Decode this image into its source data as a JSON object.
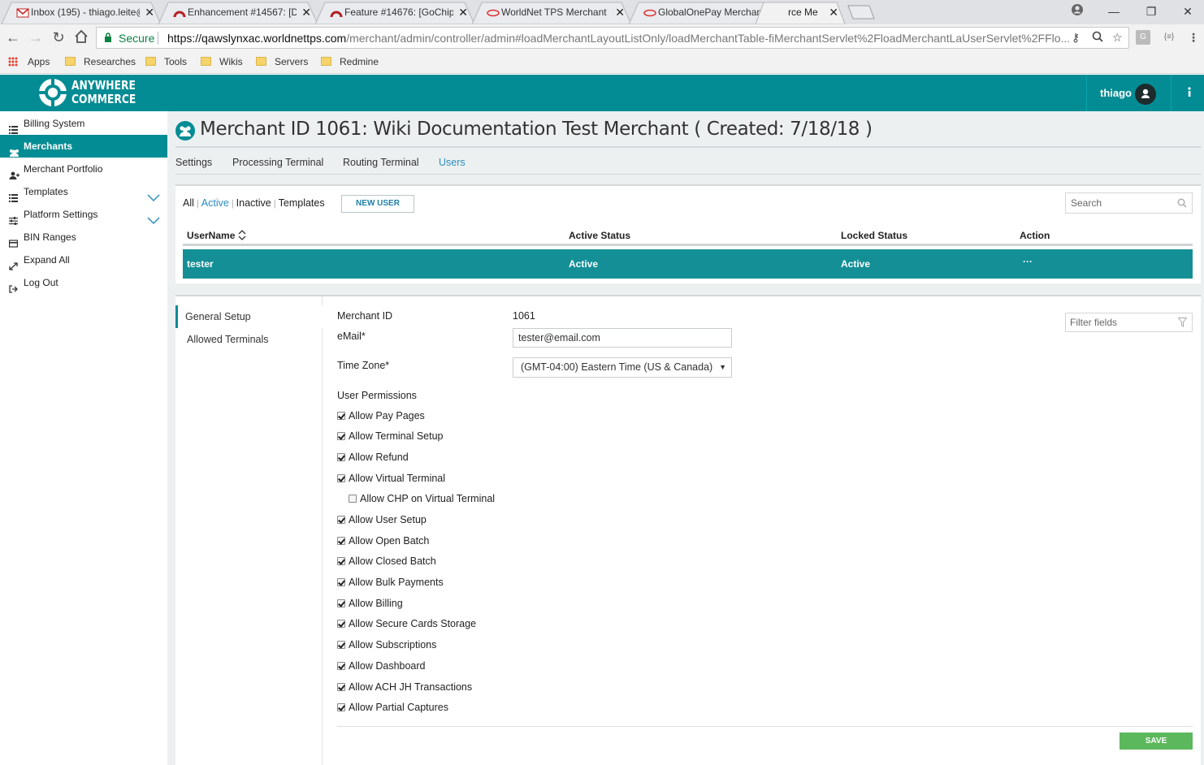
{
  "browser": {
    "tabs": [
      {
        "title": "Inbox (195) - thiago.leite@",
        "close": "✕"
      },
      {
        "title": "Enhancement #14567: [D",
        "close": "✕"
      },
      {
        "title": "Feature #14676: [GoChip",
        "close": "✕"
      },
      {
        "title": "WorldNet TPS Merchant",
        "close": "✕"
      },
      {
        "title": "GlobalOnePay Merchant",
        "close": "✕"
      },
      {
        "title": "rce Me",
        "close": "✕"
      }
    ],
    "address": {
      "secure_label": "Secure",
      "url_host": "https://qawslynxac.worldnettps.com",
      "url_path": "/merchant/admin/controller/admin#loadMerchantLayoutListOnly/loadMerchantTable-fiMerchantServlet%2FloadMerchantLaUserServlet%2FFlo..."
    },
    "bookmarks": [
      "Apps",
      "Researches",
      "Tools",
      "Wikis",
      "Servers",
      "Redmine"
    ]
  },
  "header": {
    "logo_line1": "ANYWHERE",
    "logo_line2": "COMMERCE",
    "username": "thiago",
    "brand_color": "#048c94"
  },
  "sidebar": {
    "items": [
      {
        "label": "Billing System",
        "icon": "list-icon"
      },
      {
        "label": "Merchants",
        "icon": "users-icon",
        "active": true
      },
      {
        "label": "Merchant Portfolio",
        "icon": "user-add-icon"
      },
      {
        "label": "Templates",
        "icon": "list-icon",
        "expandable": true
      },
      {
        "label": "Platform Settings",
        "icon": "sliders-icon",
        "expandable": true
      },
      {
        "label": "BIN Ranges",
        "icon": "card-icon"
      },
      {
        "label": "Expand All",
        "icon": "expand-icon"
      },
      {
        "label": "Log Out",
        "icon": "logout-icon"
      }
    ]
  },
  "main": {
    "title": "Merchant ID 1061: Wiki Documentation Test Merchant ( Created: 7/18/18 )",
    "tabs": [
      "Settings",
      "Processing Terminal",
      "Routing Terminal",
      "Users"
    ],
    "active_tab": "Users",
    "filters": {
      "all": "All",
      "active": "Active",
      "inactive": "Inactive",
      "templates": "Templates"
    },
    "new_user_label": "NEW USER",
    "search_placeholder": "Search",
    "table": {
      "headers": [
        "UserName",
        "Active Status",
        "Locked Status",
        "Action"
      ],
      "rows": [
        {
          "username": "tester",
          "active_status": "Active",
          "locked_status": "Active",
          "action": "···"
        }
      ]
    },
    "detail": {
      "nav": [
        "General Setup",
        "Allowed Terminals"
      ],
      "labels": {
        "merchant_id": "Merchant ID",
        "email": "eMail*",
        "time_zone": "Time Zone*",
        "permissions": "User Permissions"
      },
      "merchant_id_value": "1061",
      "email_value": "tester@email.com",
      "time_zone_value": "(GMT-04:00) Eastern Time (US & Canada)",
      "filter_placeholder": "Filter fields",
      "permissions": [
        {
          "label": "Allow Pay Pages",
          "checked": true
        },
        {
          "label": "Allow Terminal Setup",
          "checked": true
        },
        {
          "label": "Allow Refund",
          "checked": true
        },
        {
          "label": "Allow Virtual Terminal",
          "checked": true
        },
        {
          "label": "Allow CHP on Virtual Terminal",
          "checked": false,
          "indent": true
        },
        {
          "label": "Allow User Setup",
          "checked": true
        },
        {
          "label": "Allow Open Batch",
          "checked": true
        },
        {
          "label": "Allow Closed Batch",
          "checked": true
        },
        {
          "label": "Allow Bulk Payments",
          "checked": true
        },
        {
          "label": "Allow Billing",
          "checked": true
        },
        {
          "label": "Allow Secure Cards Storage",
          "checked": true
        },
        {
          "label": "Allow Subscriptions",
          "checked": true
        },
        {
          "label": "Allow Dashboard",
          "checked": true
        },
        {
          "label": "Allow ACH JH Transactions",
          "checked": true
        },
        {
          "label": "Allow Partial Captures",
          "checked": true
        }
      ],
      "save_label": "SAVE"
    }
  }
}
